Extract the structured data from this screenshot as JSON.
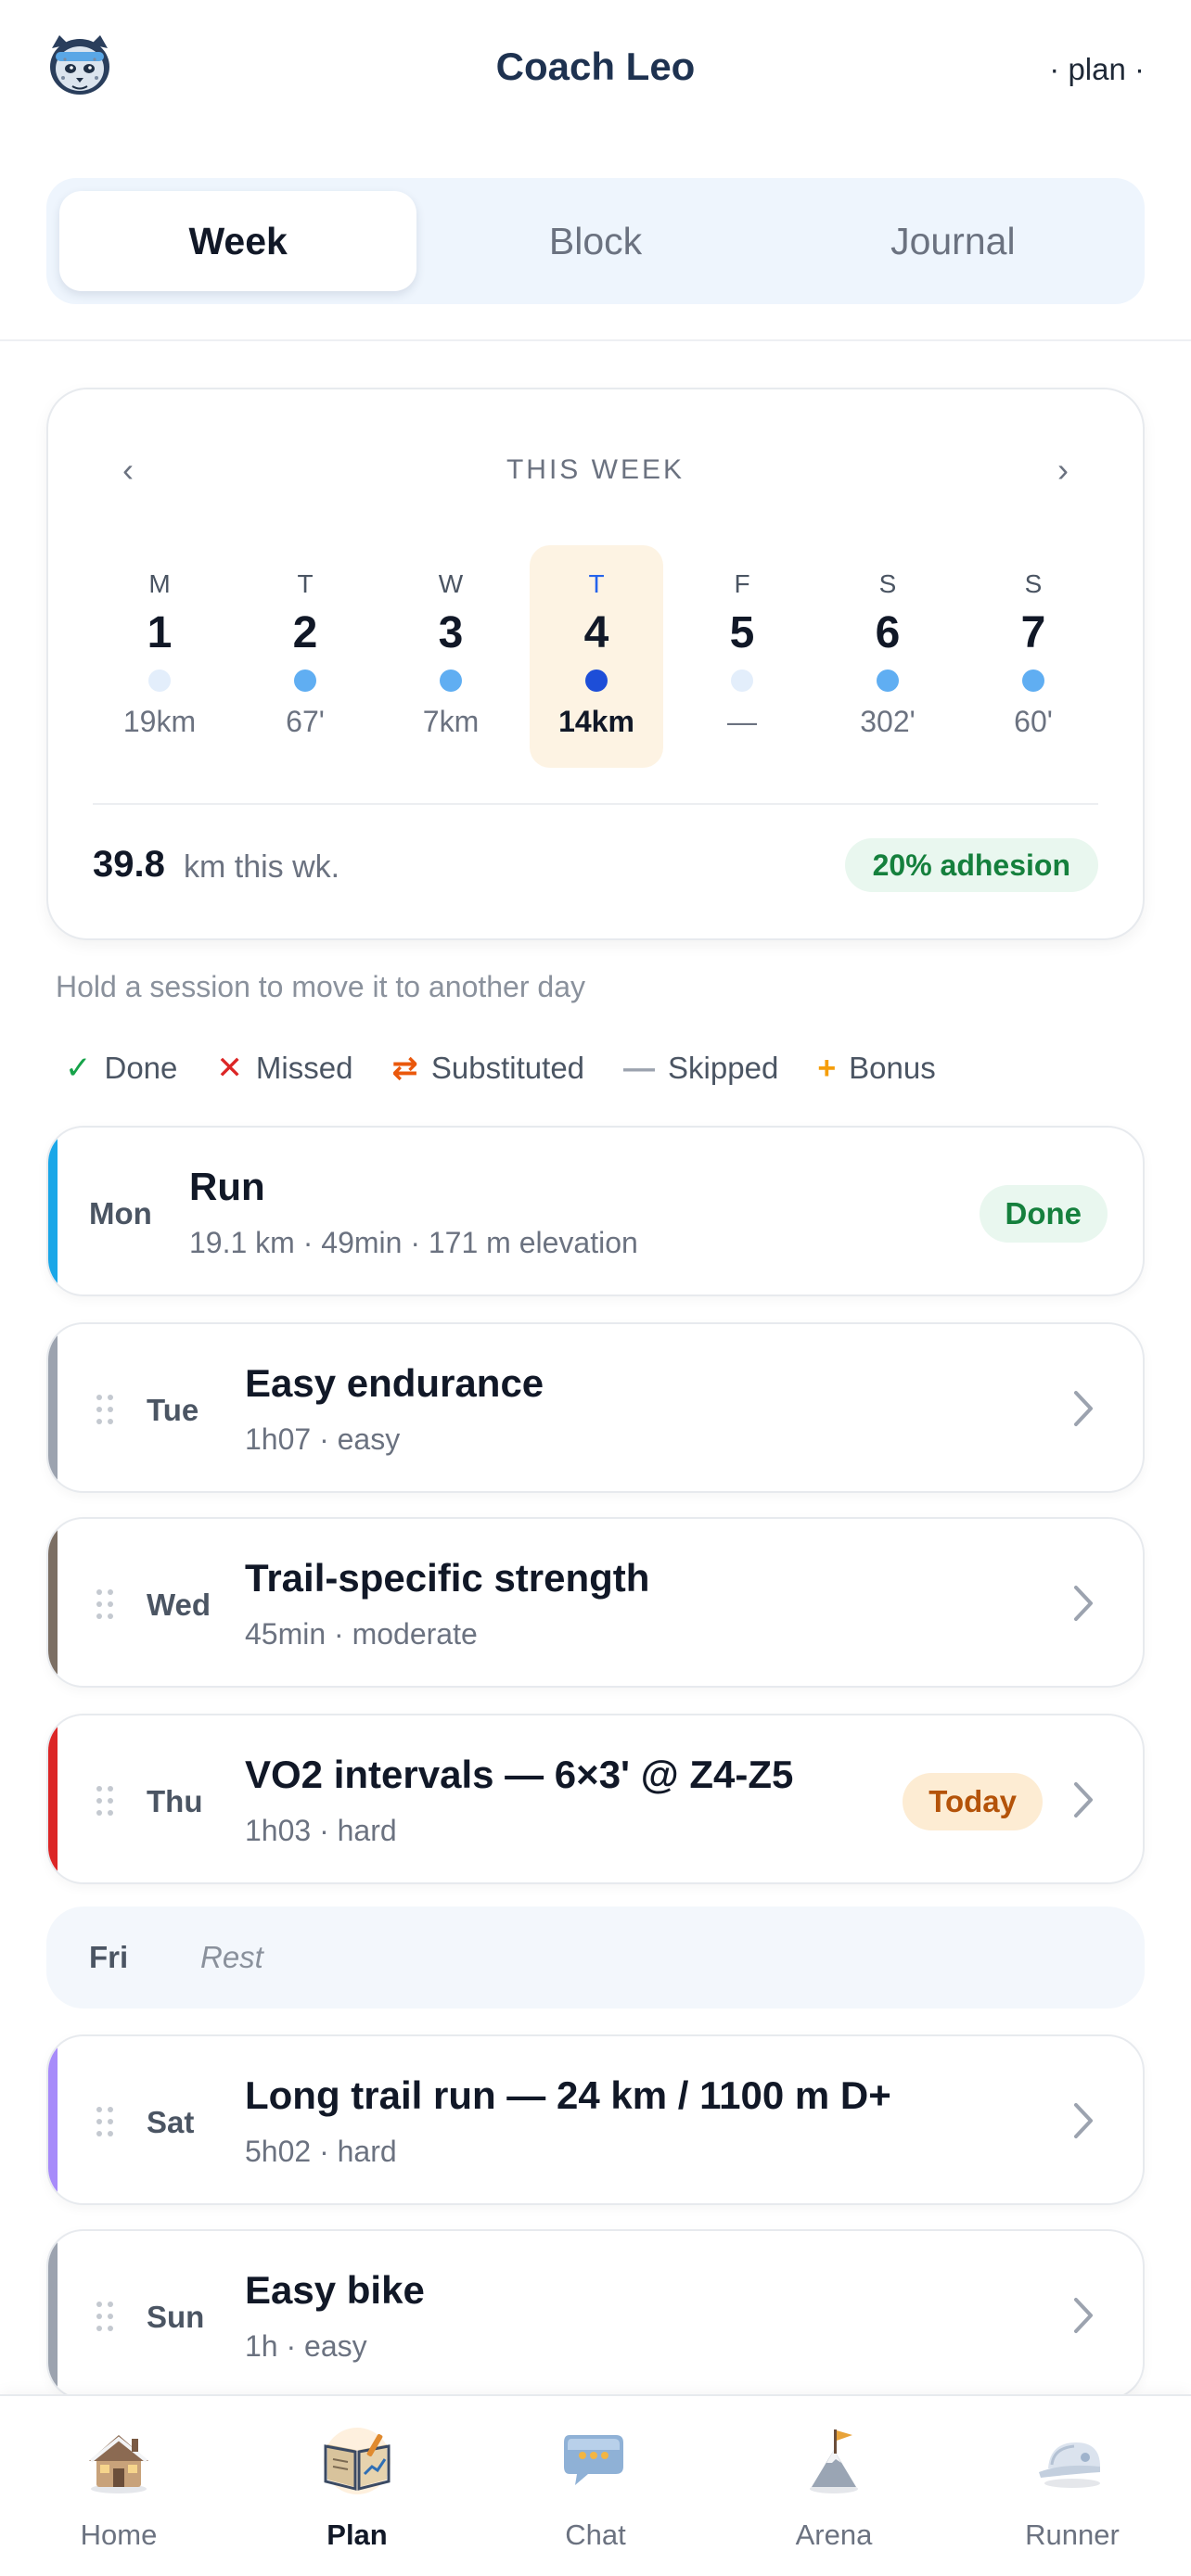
{
  "header": {
    "title": "Coach Leo",
    "plan_tag": "· plan ·"
  },
  "tabs": [
    {
      "label": "Week",
      "active": true
    },
    {
      "label": "Block",
      "active": false
    },
    {
      "label": "Journal",
      "active": false
    }
  ],
  "week": {
    "title": "THIS WEEK",
    "prev": "‹",
    "next": "›",
    "days": [
      {
        "letter": "M",
        "num": "1",
        "value": "19km",
        "dot": "#e3eefb"
      },
      {
        "letter": "T",
        "num": "2",
        "value": "67'",
        "dot": "#60aef2"
      },
      {
        "letter": "W",
        "num": "3",
        "value": "7km",
        "dot": "#60aef2"
      },
      {
        "letter": "T",
        "num": "4",
        "value": "14km",
        "dot": "#1d4ed8",
        "today": true
      },
      {
        "letter": "F",
        "num": "5",
        "value": "—",
        "dot": "#e3eefb"
      },
      {
        "letter": "S",
        "num": "6",
        "value": "302'",
        "dot": "#60aef2"
      },
      {
        "letter": "S",
        "num": "7",
        "value": "60'",
        "dot": "#60aef2"
      }
    ],
    "km_total": "39.8",
    "km_label": "km this wk.",
    "adhesion": "20% adhesion"
  },
  "hint": "Hold a session to move it to another day",
  "legend": [
    {
      "symbol": "✓",
      "label": "Done",
      "color": "#16a34a"
    },
    {
      "symbol": "✕",
      "label": "Missed",
      "color": "#dc2626"
    },
    {
      "symbol": "⇄",
      "label": "Substituted",
      "color": "#ea580c"
    },
    {
      "symbol": "—",
      "label": "Skipped",
      "color": "#9ca3af"
    },
    {
      "symbol": "+",
      "label": "Bonus",
      "color": "#f59e0b"
    }
  ],
  "sessions": [
    {
      "day": "Mon",
      "title": "Run",
      "sub": "19.1 km · 49min · 171 m elevation",
      "badge": "Done",
      "accent": "#1aa7e8"
    },
    {
      "day": "Tue",
      "title": "Easy endurance",
      "sub": "1h07 · easy",
      "accent": "#9ca3af"
    },
    {
      "day": "Wed",
      "title": "Trail-specific strength",
      "sub": "45min · moderate",
      "accent": "#7c6f64"
    },
    {
      "day": "Thu",
      "title": "VO2 intervals — 6×3' @ Z4-Z5",
      "sub": "1h03 · hard",
      "badge": "Today",
      "accent": "#dc2626"
    },
    {
      "day": "Sat",
      "title": "Long trail run — 24 km / 1100 m D+",
      "sub": "5h02 · hard",
      "accent": "#a78bfa"
    },
    {
      "day": "Sun",
      "title": "Easy bike",
      "sub": "1h · easy",
      "accent": "#9ca3af"
    }
  ],
  "rest": {
    "day": "Fri",
    "label": "Rest"
  },
  "nav": [
    {
      "label": "Home",
      "icon": "house-icon"
    },
    {
      "label": "Plan",
      "icon": "plan-book-icon",
      "active": true
    },
    {
      "label": "Chat",
      "icon": "chat-bubble-icon"
    },
    {
      "label": "Arena",
      "icon": "mountain-flag-icon"
    },
    {
      "label": "Runner",
      "icon": "cap-icon"
    }
  ]
}
